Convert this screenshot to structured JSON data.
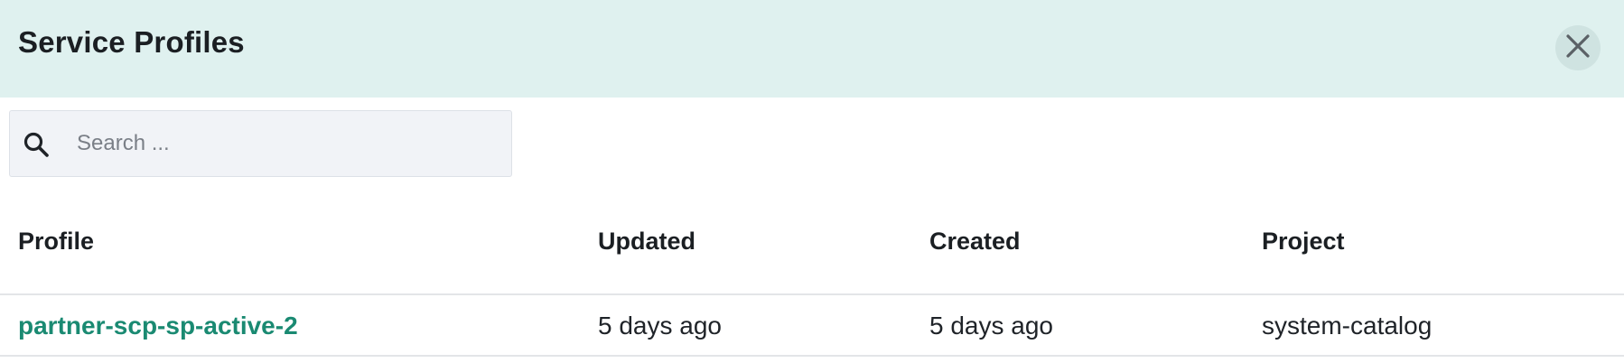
{
  "header": {
    "title": "Service Profiles",
    "close_icon": "close-icon"
  },
  "search": {
    "placeholder": "Search ...",
    "value": "",
    "icon": "search-icon"
  },
  "table": {
    "columns": [
      "Profile",
      "Updated",
      "Created",
      "Project"
    ],
    "rows": [
      {
        "profile": "partner-scp-sp-active-2",
        "updated": "5 days ago",
        "created": "5 days ago",
        "project": "system-catalog"
      }
    ]
  },
  "colors": {
    "header_bg": "#dff1ef",
    "link": "#1a8a72",
    "search_bg": "#f1f3f7"
  }
}
